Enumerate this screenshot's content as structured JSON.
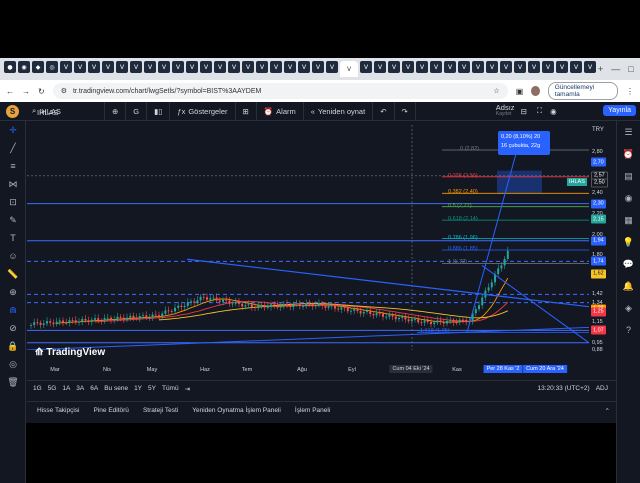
{
  "browser": {
    "tab_glyphs": [
      "●",
      "◉",
      "◆",
      "◎",
      "V",
      "V",
      "V",
      "V",
      "V",
      "V",
      "V",
      "V",
      "V",
      "V",
      "V",
      "V",
      "V",
      "V",
      "V",
      "V",
      "V",
      "V",
      "V",
      "V",
      "V",
      "V",
      "V",
      "V",
      "V",
      "V",
      "V",
      "V",
      "V",
      "V",
      "V",
      "V",
      "V",
      "V",
      "V",
      "V",
      "V",
      "V"
    ],
    "new_tab": "+",
    "url": "tr.tradingview.com/chart/lwgSetls/?symbol=BIST%3AAYDEM",
    "update_button": "Güncellemeyi tamamla"
  },
  "toolbar": {
    "symbol": "IHLAS",
    "interval": "G",
    "indicators": "Göstergeler",
    "alarm": "Alarm",
    "replay": "Yeniden oynat",
    "layout_name": "Adsız",
    "layout_sub": "Kaydet",
    "publish": "Yayınla",
    "currency": "TRY"
  },
  "chart_data": {
    "type": "candlestick",
    "symbol": "IHLAS",
    "x_labels": [
      "Mar",
      "Nis",
      "May",
      "Haz",
      "Tem",
      "Ağu",
      "Eyl",
      "Kas"
    ],
    "x_highlight_left": "Cum 04 Eki '24",
    "x_highlight_right": "Per 28 Kas '2",
    "x_highlight_right2": "Cum 20 Ara '24",
    "y_ticks": [
      "2,80",
      "2,40",
      "2,20",
      "2,00",
      "1,80",
      "1,42",
      "1,34",
      "1,27",
      "1,15",
      "1,07",
      "0,95",
      "0,88"
    ],
    "price_tags": [
      {
        "label": "2,70",
        "color": "#2962ff"
      },
      {
        "label": "2,57",
        "color": "#131722"
      },
      {
        "label": "2,50",
        "color": "#131722"
      },
      {
        "label": "2,30",
        "color": "#2962ff"
      },
      {
        "label": "2,15",
        "color": "#26a69a"
      },
      {
        "label": "1,94",
        "color": "#2962ff"
      },
      {
        "label": "1,74",
        "color": "#2962ff"
      },
      {
        "label": "1,62",
        "color": "#f7c325"
      },
      {
        "label": "1,27",
        "color": "#ff6d00"
      },
      {
        "label": "1,28",
        "color": "#ff9800"
      },
      {
        "label": "1,25",
        "color": "#f23645"
      },
      {
        "label": "1,07",
        "color": "#f23645"
      }
    ],
    "fib_levels": [
      {
        "label": "0 (2,82)",
        "color": "#787b86"
      },
      {
        "label": "0.236 (2,56)",
        "color": "#f23645"
      },
      {
        "label": "0.382 (2,40)",
        "color": "#ff9800"
      },
      {
        "label": "0.5 (2,27)",
        "color": "#4caf50"
      },
      {
        "label": "0.618 (2,14)",
        "color": "#089981"
      },
      {
        "label": "0.786 (1,96)",
        "color": "#00bcd4"
      },
      {
        "label": "0.886 (1,85)",
        "color": "#2962ff"
      },
      {
        "label": "1 (1,72)",
        "color": "#787b86"
      },
      {
        "label": "1.618 (1,05)",
        "color": "#2962ff"
      }
    ],
    "tooltip_line1": "0,20 (8,10%) 20",
    "tooltip_line2": "16 çubukta, 22g",
    "last_price_label": "IHLAS",
    "last_price": "2,50"
  },
  "bottom": {
    "ranges": [
      "1G",
      "5G",
      "1A",
      "3A",
      "6A",
      "Bu sene",
      "1Y",
      "5Y",
      "Tümü"
    ],
    "time": "13:20:33 (UTC+2)",
    "adj": "ADJ",
    "panels": [
      "Hisse Takipçisi",
      "Pine Editörü",
      "Strateji Testi",
      "Yeniden Oynatma İşlem Paneli",
      "İşlem Paneli"
    ]
  },
  "watermark": "TradingView"
}
